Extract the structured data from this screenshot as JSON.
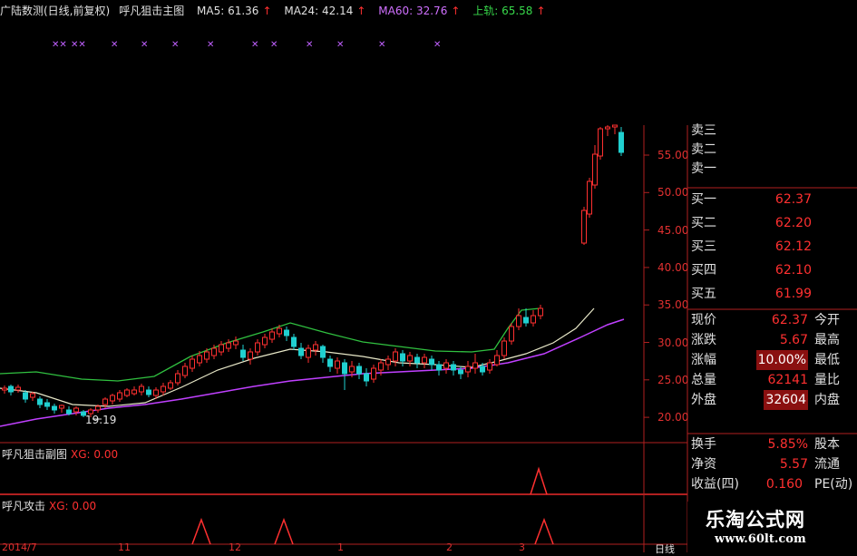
{
  "header": {
    "title": "广陆数测(日线,前复权)",
    "indicator": "呼凡狙击主图",
    "ma5": "MA5: 61.36",
    "ma24": "MA24: 42.14",
    "ma60": "MA60: 32.76",
    "upper": "上轨: 65.58"
  },
  "markers": [
    "✕✕",
    "✕✕",
    "✕",
    "✕",
    "✕",
    "✕",
    "✕",
    "✕",
    "✕",
    "✕",
    "✕",
    "✕"
  ],
  "price_axis": [
    "55.00",
    "50.00",
    "45.00",
    "40.00",
    "35.00",
    "30.00",
    "25.00",
    "20.00"
  ],
  "low_annotation": "19.19",
  "sub_panel_1": {
    "name": "呼凡狙击副图",
    "xg": "XG: 0.00"
  },
  "sub_panel_2": {
    "name": "呼凡攻击",
    "xg": "XG: 0.00"
  },
  "bottom_axis": [
    "2014/7",
    "11",
    "12",
    "1",
    "2",
    "3"
  ],
  "bottom_right": "日线",
  "sell_orders": [
    {
      "label": "卖三",
      "price": ""
    },
    {
      "label": "卖二",
      "price": ""
    },
    {
      "label": "卖一",
      "price": ""
    }
  ],
  "buy_orders": [
    {
      "label": "买一",
      "price": "62.37"
    },
    {
      "label": "买二",
      "price": "62.20"
    },
    {
      "label": "买三",
      "price": "62.12"
    },
    {
      "label": "买四",
      "price": "62.10"
    },
    {
      "label": "买五",
      "price": "61.99"
    }
  ],
  "quote": [
    {
      "l1": "现价",
      "v": "62.37",
      "l2": "今开",
      "hl": false
    },
    {
      "l1": "涨跌",
      "v": "5.67",
      "l2": "最高",
      "hl": false
    },
    {
      "l1": "涨幅",
      "v": "10.00%",
      "l2": "最低",
      "hl": true
    },
    {
      "l1": "总量",
      "v": "62141",
      "l2": "量比",
      "hl": false
    },
    {
      "l1": "外盘",
      "v": "32604",
      "l2": "内盘",
      "hl": true
    },
    {
      "l1": "换手",
      "v": "5.85%",
      "l2": "股本",
      "hl": false
    },
    {
      "l1": "净资",
      "v": "5.57",
      "l2": "流通",
      "hl": false
    },
    {
      "l1": "收益(四)",
      "v": "0.160",
      "l2": "PE(动)",
      "hl": false
    }
  ],
  "watermark": {
    "title": "乐淘公式网",
    "url": "www.60lt.com"
  },
  "colors": {
    "up": "#ff3030",
    "down": "#20d0d0",
    "ma60": "#c040ff",
    "band": "#30c040",
    "mid": "#e8e8c8"
  }
}
